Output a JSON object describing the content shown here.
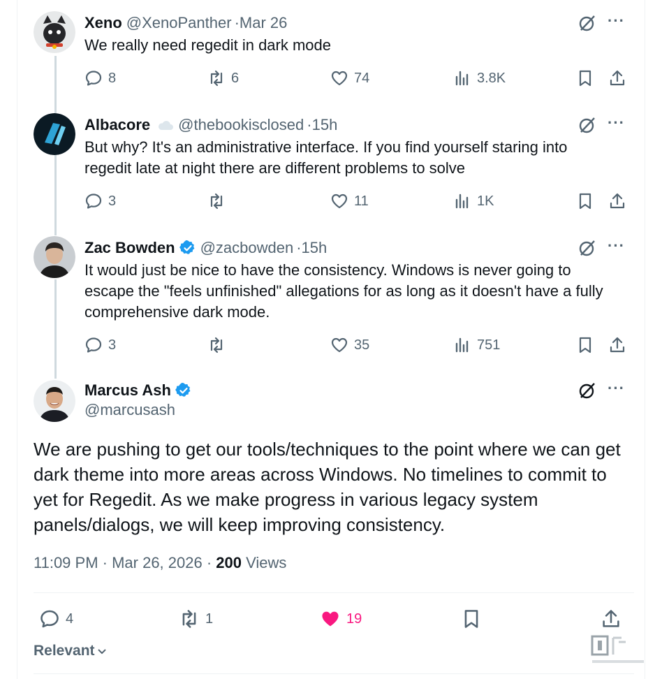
{
  "replies": [
    {
      "name": "Xeno",
      "handle": "@XenoPanther",
      "time": "Mar 26",
      "text": "We really need regedit in dark mode",
      "stats": {
        "replies": "8",
        "reposts": "6",
        "likes": "74",
        "views": "3.8K"
      }
    },
    {
      "name": "Albacore",
      "handle": "@thebookisclosed",
      "time": "15h",
      "text": "But why? It's an administrative interface. If you find yourself staring into regedit late at night there are different problems to solve",
      "stats": {
        "replies": "3",
        "reposts": "",
        "likes": "11",
        "views": "1K"
      }
    },
    {
      "name": "Zac Bowden",
      "handle": "@zacbowden",
      "time": "15h",
      "text": "It would just be nice to have the consistency. Windows is never going to escape the \"feels unfinished\" allegations for as long as it doesn't have a fully comprehensive dark mode.",
      "stats": {
        "replies": "3",
        "reposts": "",
        "likes": "35",
        "views": "751"
      }
    }
  ],
  "main": {
    "name": "Marcus Ash",
    "handle": "@marcusash",
    "text": "We are pushing to get our tools/techniques to the point where we can get dark theme into more areas across Windows. No timelines to commit to yet for Regedit. As we make progress in various legacy system panels/dialogs, we will keep improving consistency.",
    "timestamp": "11:09 PM · Mar 26, 2026 · ",
    "views_count": "200",
    "views_label": " Views",
    "stats": {
      "replies": "4",
      "reposts": "1",
      "likes": "19"
    },
    "sort_label": "Relevant"
  },
  "separator": " · ",
  "more_label": "···",
  "icons": [
    "reply-icon",
    "repost-icon",
    "like-icon",
    "views-icon",
    "bookmark-icon",
    "share-icon",
    "grok-icon",
    "more-icon",
    "verified-icon",
    "cloud-icon"
  ],
  "colors": {
    "text": "#0f1419",
    "muted": "#536471",
    "verified": "#1d9bf0",
    "liked": "#f91880",
    "thread": "#cfd9de"
  }
}
